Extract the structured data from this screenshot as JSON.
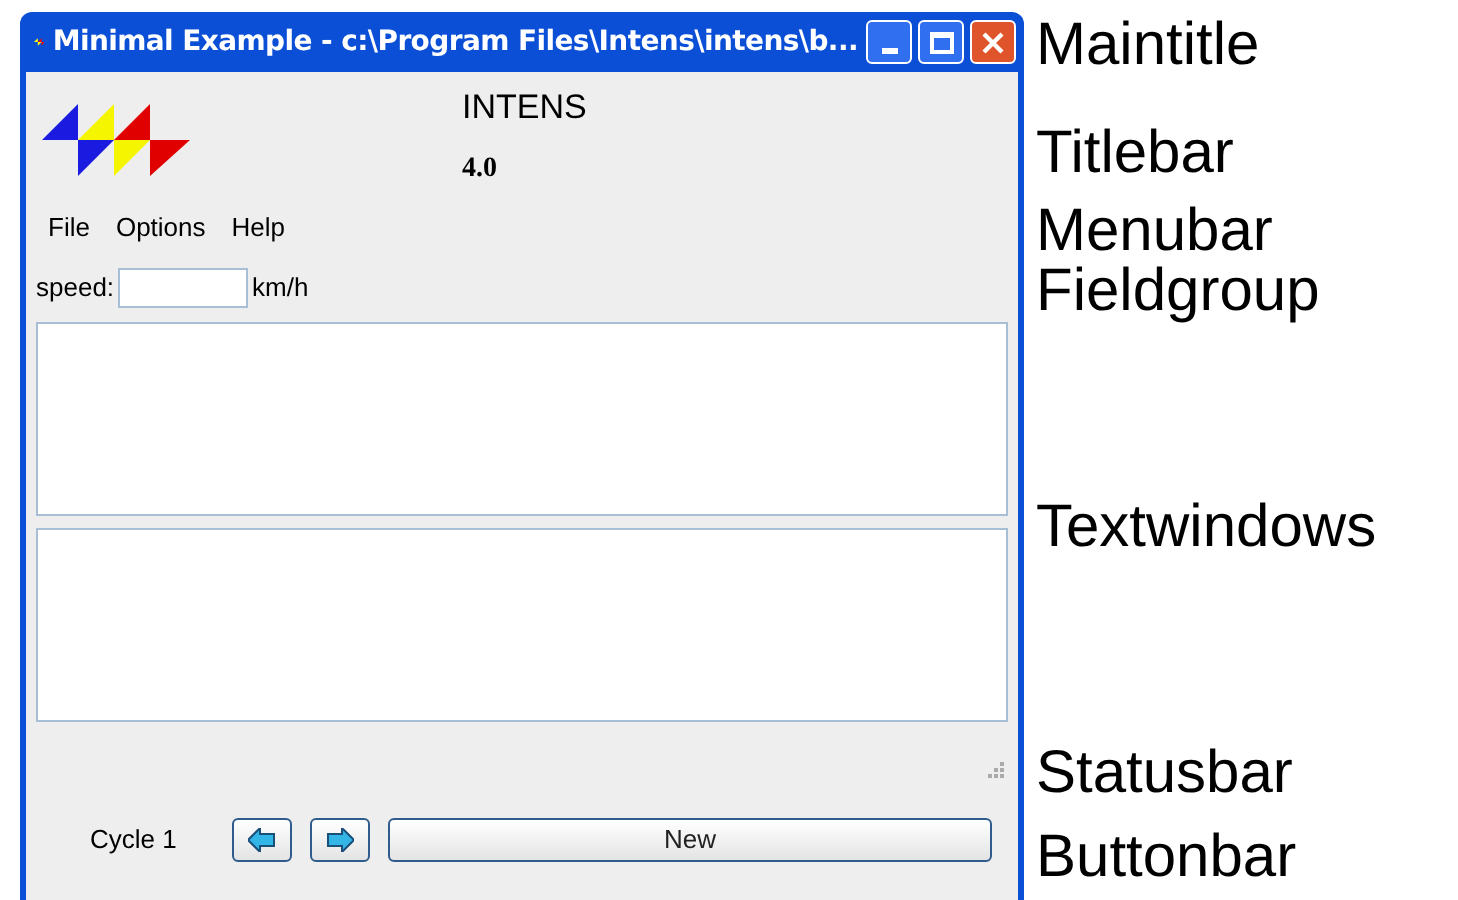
{
  "window": {
    "title": "Minimal Example - c:\\Program Files\\Intens\\intens\\b..."
  },
  "titlebar": {
    "product": "INTENS",
    "version": "4.0"
  },
  "menubar": [
    "File",
    "Options",
    "Help"
  ],
  "fieldgroup": {
    "label": "speed:",
    "unit": "km/h"
  },
  "text_windows": [
    {
      "kind": "text"
    },
    {
      "kind": "text"
    }
  ],
  "buttonbar": {
    "cycle": "Cycle 1",
    "buttons": [
      {
        "kind": "back"
      },
      {
        "kind": "forward"
      },
      {
        "kind": "text",
        "label": "New"
      }
    ]
  },
  "annotations": [
    "Maintitle",
    "Titlebar",
    "Menubar",
    "Fieldgroup",
    "Textwindows",
    "Statusbar",
    "Buttonbar"
  ]
}
